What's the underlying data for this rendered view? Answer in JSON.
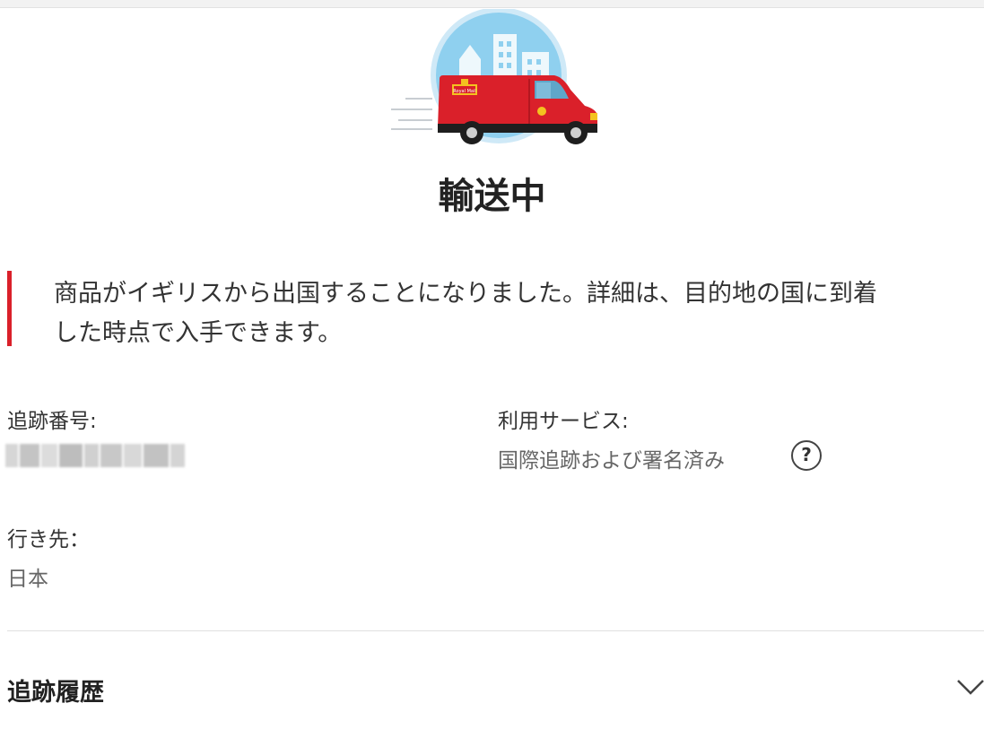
{
  "status": {
    "title": "輸送中"
  },
  "notice": {
    "line1": "商品がイギリスから出国することになりました。詳細は、目的地の国に到着",
    "line2": "した時点で入手できます。",
    "accent_color": "#da202a"
  },
  "details": {
    "tracking_label": "追跡番号:",
    "service_label": "利用サービス:",
    "service_value": "国際追跡および署名済み",
    "help_icon": "?",
    "destination_label": "行き先：",
    "destination_value": "日本"
  },
  "history": {
    "title": "追跡履歴",
    "expand_icon": "chevron-down-icon"
  },
  "van": {
    "badge_text": "Royal Mail",
    "body_color": "#da202a",
    "sky_color": "#8fd0ef"
  }
}
